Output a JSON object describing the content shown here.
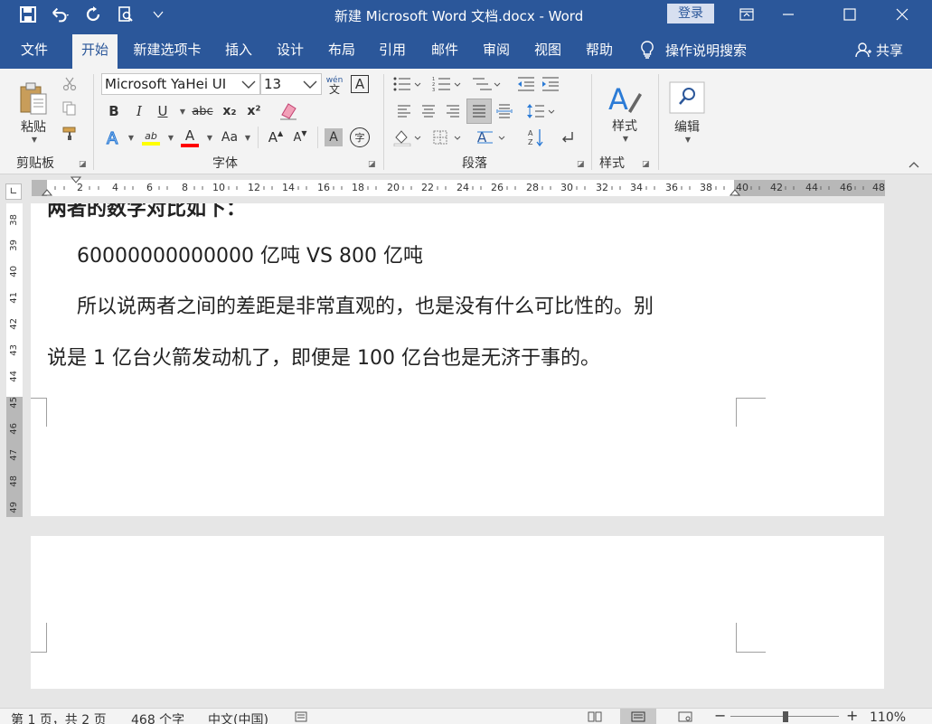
{
  "window": {
    "title": "新建 Microsoft Word 文档.docx  -  Word",
    "login": "登录"
  },
  "tabs": [
    "文件",
    "开始",
    "新建选项卡",
    "插入",
    "设计",
    "布局",
    "引用",
    "邮件",
    "审阅",
    "视图",
    "帮助"
  ],
  "tell_me": "操作说明搜索",
  "share": "共享",
  "clipboard": {
    "label": "剪贴板",
    "paste": "粘贴"
  },
  "font": {
    "label": "字体",
    "name": "Microsoft YaHei UI",
    "size": "13",
    "bold": "B",
    "italic": "I",
    "underline": "U",
    "strike": "abc",
    "sub": "x₂",
    "sup": "x²",
    "highlight": "ab",
    "color": "A",
    "case": "Aa",
    "grow": "A",
    "shrink": "A",
    "shade": "A",
    "phonetic": "wén",
    "phonetic_char": "文",
    "border_char": "A",
    "enclose": "字",
    "effect": "A",
    "highlight_color": "#ffff00",
    "font_color": "#ff0000"
  },
  "paragraph": {
    "label": "段落"
  },
  "styles": {
    "label": "样式",
    "button": "样式"
  },
  "editing": {
    "button": "编辑"
  },
  "hruler_ticks": [
    "2",
    "4",
    "6",
    "8",
    "10",
    "12",
    "14",
    "16",
    "18",
    "20",
    "22",
    "24",
    "26",
    "28",
    "30",
    "32",
    "34",
    "36",
    "38",
    "40",
    "42",
    "44",
    "46",
    "48"
  ],
  "vruler_ticks": [
    "38",
    "39",
    "40",
    "41",
    "42",
    "43",
    "44",
    "45",
    "46",
    "47",
    "48",
    "49"
  ],
  "document": {
    "cut_line": "两者的数字对比如下：",
    "line1": "60000000000000 亿吨  VS 800 亿吨",
    "line2": "所以说两者之间的差距是非常直观的，也是没有什么可比性的。别",
    "line3": "说是 1 亿台火箭发动机了，即便是 100 亿台也是无济于事的。"
  },
  "status": {
    "page": "第 1 页，共 2 页",
    "words": "468 个字",
    "lang": "中文(中国)",
    "zoom": "110%"
  },
  "colors": {
    "brand": "#2b579a",
    "ribbon": "#f3f3f3",
    "canvas": "#e6e6e6"
  }
}
